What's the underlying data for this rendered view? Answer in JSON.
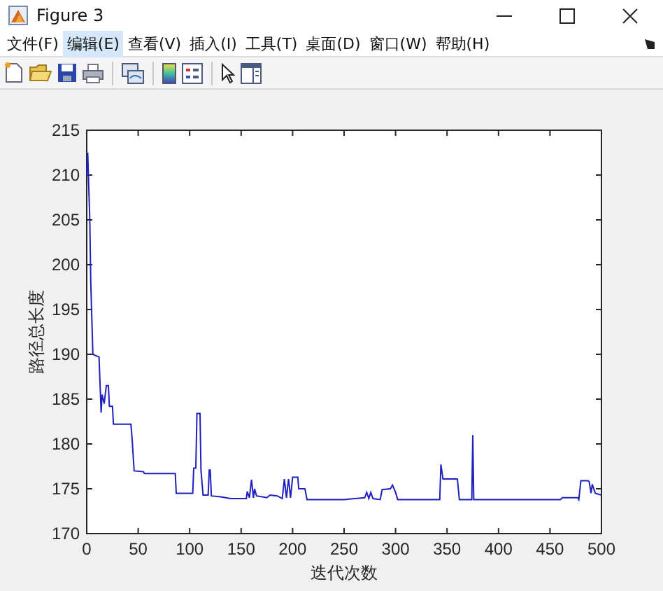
{
  "window": {
    "title": "Figure 3"
  },
  "menu": [
    {
      "label": "文件(F)",
      "selected": false
    },
    {
      "label": "编辑(E)",
      "selected": true
    },
    {
      "label": "查看(V)",
      "selected": false
    },
    {
      "label": "插入(I)",
      "selected": false
    },
    {
      "label": "工具(T)",
      "selected": false
    },
    {
      "label": "桌面(D)",
      "selected": false
    },
    {
      "label": "窗口(W)",
      "selected": false
    },
    {
      "label": "帮助(H)",
      "selected": false
    }
  ],
  "chart": {
    "chart_data": {
      "type": "line",
      "xlabel": "迭代次数",
      "ylabel": "路径总长度",
      "xlim": [
        0,
        500
      ],
      "ylim": [
        170,
        215
      ],
      "xticks": [
        0,
        50,
        100,
        150,
        200,
        250,
        300,
        350,
        400,
        450,
        500
      ],
      "yticks": [
        170,
        175,
        180,
        185,
        190,
        195,
        200,
        205,
        210,
        215
      ],
      "x": [
        0,
        1,
        3,
        4,
        6,
        12,
        14,
        15,
        17,
        19,
        21,
        22,
        25,
        26,
        43,
        44,
        46,
        55,
        56,
        86,
        87,
        103,
        104,
        106,
        107,
        110,
        111,
        113,
        118,
        119,
        120,
        121,
        130,
        140,
        155,
        156,
        158,
        160,
        162,
        163,
        165,
        175,
        178,
        185,
        190,
        192,
        194,
        196,
        198,
        200,
        205,
        206,
        212,
        214,
        250,
        260,
        270,
        272,
        274,
        276,
        278,
        285,
        287,
        295,
        297,
        300,
        302,
        343,
        344,
        346,
        360,
        362,
        374,
        375,
        376,
        460,
        462,
        477,
        478,
        480,
        487,
        488,
        490,
        491,
        494,
        500
      ],
      "series": [
        {
          "color": "#2020c0",
          "values": [
            210,
            212.5,
            205,
            198,
            190,
            189.7,
            183.5,
            185.5,
            184.5,
            186.5,
            186.5,
            184.2,
            184.2,
            182.2,
            182.2,
            180.7,
            177,
            176.9,
            176.7,
            176.7,
            174.5,
            174.5,
            177.3,
            177.3,
            183.4,
            183.4,
            177,
            174.3,
            174.3,
            177.1,
            177.1,
            174.2,
            174.1,
            173.9,
            173.9,
            174.7,
            174,
            176,
            174,
            175,
            174.2,
            174,
            174.3,
            174.2,
            173.9,
            176.1,
            174,
            176.1,
            174,
            176.3,
            176.3,
            175,
            175,
            173.8,
            173.8,
            173.9,
            174,
            174.6,
            173.9,
            174.6,
            173.9,
            173.8,
            174.9,
            175,
            175.4,
            174.6,
            173.8,
            173.8,
            177.7,
            176.1,
            176.1,
            173.8,
            173.8,
            181,
            173.8,
            173.8,
            174,
            174,
            173.8,
            175.9,
            175.9,
            175.8,
            174.5,
            175.5,
            174.5,
            174.3
          ]
        }
      ]
    }
  }
}
